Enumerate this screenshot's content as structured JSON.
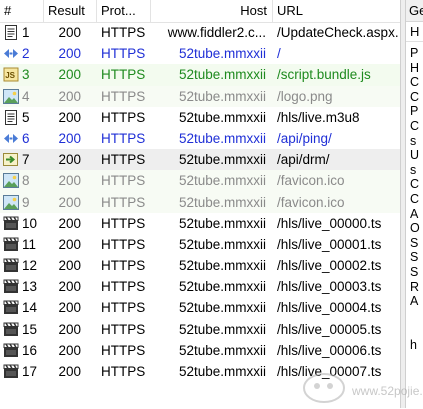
{
  "columns": {
    "num": "#",
    "result": "Result",
    "protocol": "Prot...",
    "host": "Host",
    "url": "URL"
  },
  "side_panel": {
    "title": "Ge",
    "tab": "H",
    "letters": [
      "P",
      "H",
      "C",
      "C",
      "P",
      "C",
      "s",
      "U",
      "s",
      "C",
      "C",
      "A",
      "O",
      "S",
      "S",
      "S",
      "R",
      "A",
      "",
      "",
      "h"
    ]
  },
  "sessions": [
    {
      "num": "1",
      "result": "200",
      "protocol": "HTTPS",
      "host": "www.fiddler2.c...",
      "url": "/UpdateCheck.aspx.",
      "icon": "document-icon",
      "style": "normal"
    },
    {
      "num": "2",
      "result": "200",
      "protocol": "HTTPS",
      "host": "52tube.mmxxii",
      "url": "/",
      "icon": "html-icon",
      "style": "html"
    },
    {
      "num": "3",
      "result": "200",
      "protocol": "HTTPS",
      "host": "52tube.mmxxii",
      "url": "/script.bundle.js",
      "icon": "script-icon",
      "style": "script"
    },
    {
      "num": "4",
      "result": "200",
      "protocol": "HTTPS",
      "host": "52tube.mmxxii",
      "url": "/logo.png",
      "icon": "image-icon",
      "style": "image"
    },
    {
      "num": "5",
      "result": "200",
      "protocol": "HTTPS",
      "host": "52tube.mmxxii",
      "url": "/hls/live.m3u8",
      "icon": "document-icon",
      "style": "normal"
    },
    {
      "num": "6",
      "result": "200",
      "protocol": "HTTPS",
      "host": "52tube.mmxxii",
      "url": "/api/ping/",
      "icon": "html-icon",
      "style": "html"
    },
    {
      "num": "7",
      "result": "200",
      "protocol": "HTTPS",
      "host": "52tube.mmxxii",
      "url": "/api/drm/",
      "icon": "arrow-icon",
      "style": "selected"
    },
    {
      "num": "8",
      "result": "200",
      "protocol": "HTTPS",
      "host": "52tube.mmxxii",
      "url": "/favicon.ico",
      "icon": "image-icon",
      "style": "image"
    },
    {
      "num": "9",
      "result": "200",
      "protocol": "HTTPS",
      "host": "52tube.mmxxii",
      "url": "/favicon.ico",
      "icon": "image-icon",
      "style": "image"
    },
    {
      "num": "10",
      "result": "200",
      "protocol": "HTTPS",
      "host": "52tube.mmxxii",
      "url": "/hls/live_00000.ts",
      "icon": "video-icon",
      "style": "normal"
    },
    {
      "num": "11",
      "result": "200",
      "protocol": "HTTPS",
      "host": "52tube.mmxxii",
      "url": "/hls/live_00001.ts",
      "icon": "video-icon",
      "style": "normal"
    },
    {
      "num": "12",
      "result": "200",
      "protocol": "HTTPS",
      "host": "52tube.mmxxii",
      "url": "/hls/live_00002.ts",
      "icon": "video-icon",
      "style": "normal"
    },
    {
      "num": "13",
      "result": "200",
      "protocol": "HTTPS",
      "host": "52tube.mmxxii",
      "url": "/hls/live_00003.ts",
      "icon": "video-icon",
      "style": "normal"
    },
    {
      "num": "14",
      "result": "200",
      "protocol": "HTTPS",
      "host": "52tube.mmxxii",
      "url": "/hls/live_00004.ts",
      "icon": "video-icon",
      "style": "normal"
    },
    {
      "num": "15",
      "result": "200",
      "protocol": "HTTPS",
      "host": "52tube.mmxxii",
      "url": "/hls/live_00005.ts",
      "icon": "video-icon",
      "style": "normal"
    },
    {
      "num": "16",
      "result": "200",
      "protocol": "HTTPS",
      "host": "52tube.mmxxii",
      "url": "/hls/live_00006.ts",
      "icon": "video-icon",
      "style": "normal"
    },
    {
      "num": "17",
      "result": "200",
      "protocol": "HTTPS",
      "host": "52tube.mmxxii",
      "url": "/hls/live_00007.ts",
      "icon": "video-icon",
      "style": "normal"
    }
  ],
  "watermark": {
    "text": "www.52pojie.cn"
  },
  "colors": {
    "normal_text": "#000000",
    "html_text": "#1f2fd6",
    "script_text": "#1e8a1e",
    "image_text": "#8a8a8a",
    "selected_bg": "#eeeeee",
    "script_bg": "#f3fbef",
    "image_bg": "#f7fbf4"
  }
}
